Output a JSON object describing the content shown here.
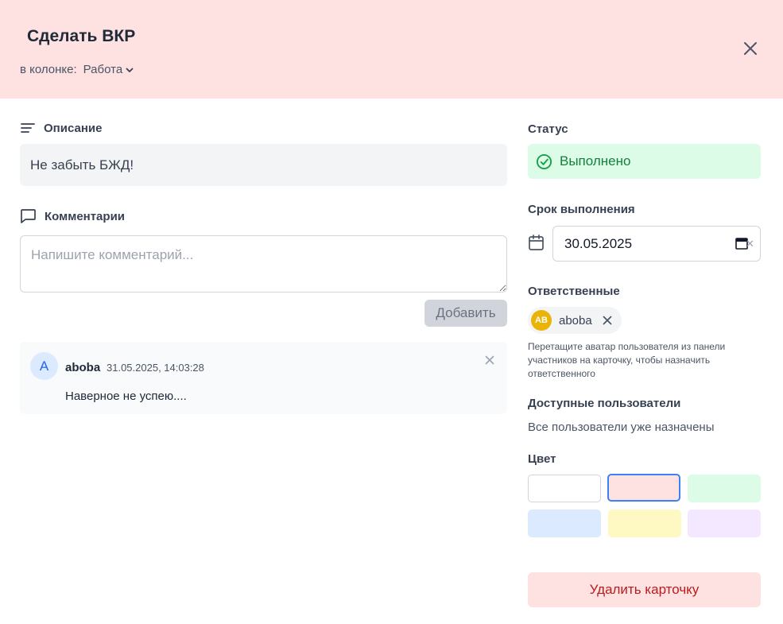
{
  "header": {
    "title": "Сделать ВКР",
    "column_prefix": "в колонке:",
    "column_value": "Работа",
    "background_color": "#fee2e2"
  },
  "icons": {
    "close": "close-icon",
    "column_dropdown": "chevron-down-icon",
    "description": "text-lines-icon",
    "comments": "message-square-icon",
    "status": "check-circle-icon",
    "calendar": "calendar-icon",
    "assignee_remove": "close-icon"
  },
  "description": {
    "label": "Описание",
    "text": "Не забыть БЖД!"
  },
  "comments": {
    "label": "Комментарии",
    "input_placeholder": "Напишите комментарий...",
    "add_button": "Добавить",
    "items": [
      {
        "avatar_letter": "A",
        "author": "aboba",
        "timestamp": "31.05.2025, 14:03:28",
        "text": "Наверное не успею...."
      }
    ]
  },
  "status": {
    "label": "Статус",
    "value": "Выполнено",
    "color": "#15803d",
    "background": "#dcfce7"
  },
  "due_date": {
    "label": "Срок выполнения",
    "value": "30.05.2025"
  },
  "assignees": {
    "label": "Ответственные",
    "items": [
      {
        "initials": "AB",
        "name": "aboba",
        "avatar_color": "#eab308"
      }
    ],
    "hint": "Перетащите аватар пользователя из панели участников на карточку, чтобы назначить ответственного"
  },
  "available_users": {
    "label": "Доступные пользователи",
    "empty_text": "Все пользователи уже назначены"
  },
  "color_picker": {
    "label": "Цвет",
    "selected_index": 1,
    "swatches": [
      {
        "color": "#ffffff"
      },
      {
        "color": "#fee2e2"
      },
      {
        "color": "#dcfce7"
      },
      {
        "color": "#dbeafe"
      },
      {
        "color": "#fef9c3"
      },
      {
        "color": "#f3e8ff"
      }
    ]
  },
  "actions": {
    "delete_card": "Удалить карточку"
  }
}
